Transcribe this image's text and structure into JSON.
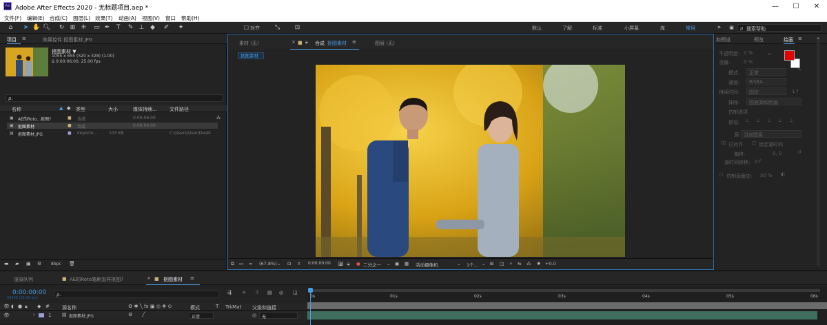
{
  "window": {
    "title": "Adobe After Effects 2020 - 无标题项目.aep *",
    "icon": "Ae",
    "minimize": "—",
    "maximize": "☐",
    "close": "✕"
  },
  "menu": [
    "文件(F)",
    "编辑(E)",
    "合成(C)",
    "图层(L)",
    "效果(T)",
    "动画(A)",
    "视图(V)",
    "窗口",
    "帮助(H)"
  ],
  "toolbar": {
    "align_label": "对齐",
    "workspaces": [
      "默认",
      "了解",
      "标准",
      "小屏幕",
      "库",
      "常用"
    ],
    "active_workspace": "常用",
    "search_placeholder": "搜索帮助"
  },
  "project": {
    "tab_label": "项目",
    "effects_tab_label": "效果控件 抠图素材.JPG",
    "item_name": "抠图素材 ▼",
    "item_dims": "1055 x 655 (520 x 328) (1.00)",
    "item_duration": "Δ 0:00:06:00, 25.00 fps",
    "search_placeholder": "ρ.",
    "columns": {
      "name": "名称",
      "type": "类型",
      "size": "大小",
      "duration": "媒体持续...",
      "path": "文件路径"
    },
    "rows": [
      {
        "name": "AE的Roto...抠图?",
        "type": "合成",
        "size": "",
        "duration": "0:00:06:00",
        "path": ""
      },
      {
        "name": "抠图素材",
        "type": "合成",
        "size": "",
        "duration": "0:00:06:00",
        "path": ""
      },
      {
        "name": "抠图素材.JPG",
        "type": "Importe...",
        "size": "103 KB",
        "duration": "",
        "path": "C:\\Users\\User\\Deskt"
      }
    ],
    "bpc": "8bpc"
  },
  "viewer": {
    "tabs": {
      "footage": "素材 (无)",
      "comp_prefix": "合成",
      "comp_name": "抠图素材",
      "layer": "图层 (无)"
    },
    "breadcrumb": "抠图素材",
    "zoom": "(67.8%)",
    "timecode": "0:00:00:00",
    "resolution": "二分之一",
    "camera": "活动摄像机",
    "views": "1个...",
    "exposure": "+0.0"
  },
  "paint": {
    "tab_label": "绘画",
    "left_tab": "和预设",
    "preview_tab": "预览",
    "opacity_label": "不透明度:",
    "opacity_value": "0 %",
    "flow_label": "流量:",
    "flow_value": "0 %",
    "mode_label": "模式:",
    "mode_value": "正常",
    "channels_label": "通道:",
    "channels_value": "RGBA",
    "duration_label": "持续时间:",
    "duration_value": "固定",
    "duration_num": "1 f",
    "erase_label": "抹除:",
    "erase_value": "图层源和绘画",
    "clone_label": "仿制选项",
    "preset_label": "预设:",
    "source_label": "源:",
    "source_value": "当前图层",
    "aligned": "已对齐",
    "lock_time": "锁定源时间",
    "offset_label": "偏移:",
    "offset_value": "0, 0",
    "source_time_label": "源时间转移:",
    "source_time_value": "0 f",
    "overlay_label": "仿制源叠加:",
    "overlay_value": "50 %",
    "fg_color": "#e60000",
    "bg_color": "#ffffff"
  },
  "timeline": {
    "tabs": [
      "渲染队列",
      "AE的Roto笔刷怎样抠图?",
      "抠图素材"
    ],
    "timecode": "0:00:00:00",
    "fps_info": "00000 (25.00 fps)",
    "search_placeholder": "ρ.",
    "columns": {
      "name": "源名称",
      "mode": "模式",
      "trkmat": "TrkMat",
      "parent": "父级和链接"
    },
    "layers": [
      {
        "index": "1",
        "name": "抠图素材.JPG",
        "mode": "正常",
        "parent": "无"
      }
    ],
    "ruler": [
      "0s",
      "01s",
      "02s",
      "03s",
      "04s",
      "05s",
      "06s"
    ]
  }
}
